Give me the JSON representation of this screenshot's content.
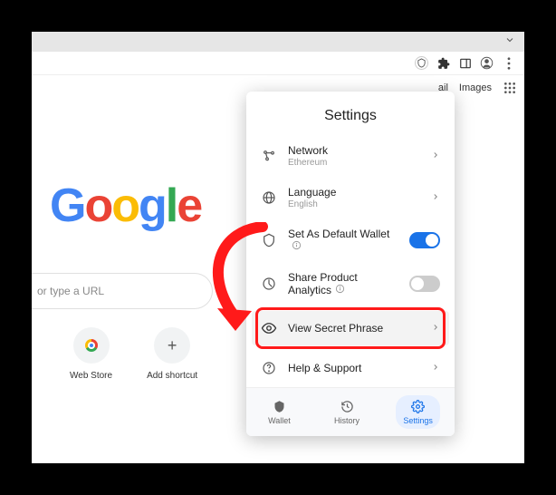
{
  "titlebar": {},
  "links": {
    "mail": "ail",
    "images": "Images"
  },
  "logo": {
    "g1": "G",
    "o1": "o",
    "o2": "o",
    "g2": "g",
    "l": "l",
    "e": "e",
    "c_blue": "#4285f4",
    "c_red": "#ea4335",
    "c_yellow": "#fbbc05",
    "c_green": "#34a853"
  },
  "search": {
    "placeholder": "or type a URL"
  },
  "tiles": {
    "webstore": "Web Store",
    "add": "Add shortcut"
  },
  "popup": {
    "title": "Settings",
    "network": {
      "label": "Network",
      "value": "Ethereum"
    },
    "language": {
      "label": "Language",
      "value": "English"
    },
    "defaultWallet": {
      "label": "Set As Default Wallet",
      "on": true
    },
    "analytics": {
      "label": "Share Product Analytics",
      "on": false
    },
    "secret": {
      "label": "View Secret Phrase"
    },
    "help": {
      "label": "Help & Support"
    }
  },
  "nav": {
    "wallet": "Wallet",
    "history": "History",
    "settings": "Settings"
  }
}
